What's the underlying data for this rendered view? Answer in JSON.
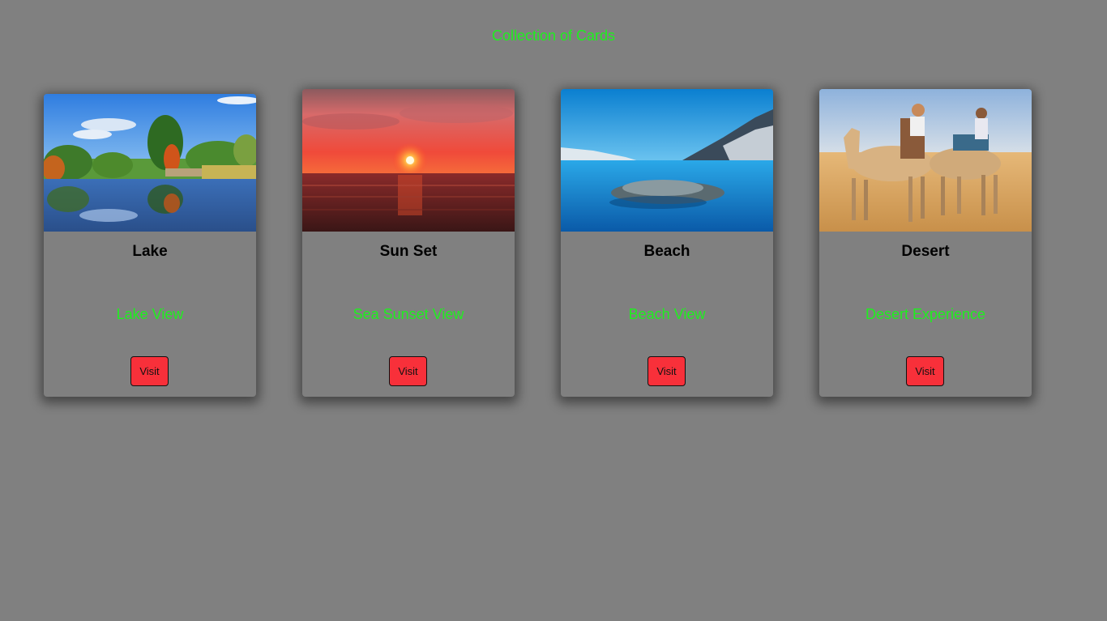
{
  "page": {
    "title": "Collection of Cards",
    "background_color": "#808080",
    "accent_text_color": "#1ef01e",
    "button_color": "#f8303a"
  },
  "cards": [
    {
      "title": "Lake",
      "description": "Lake View",
      "button_label": "Visit",
      "image": "lake-photo"
    },
    {
      "title": "Sun Set",
      "description": "Sea Sunset View",
      "button_label": "Visit",
      "image": "sunset-photo"
    },
    {
      "title": "Beach",
      "description": "Beach View",
      "button_label": "Visit",
      "image": "beach-photo"
    },
    {
      "title": "Desert",
      "description": "Desert Experience",
      "button_label": "Visit",
      "image": "desert-camels-photo"
    }
  ]
}
